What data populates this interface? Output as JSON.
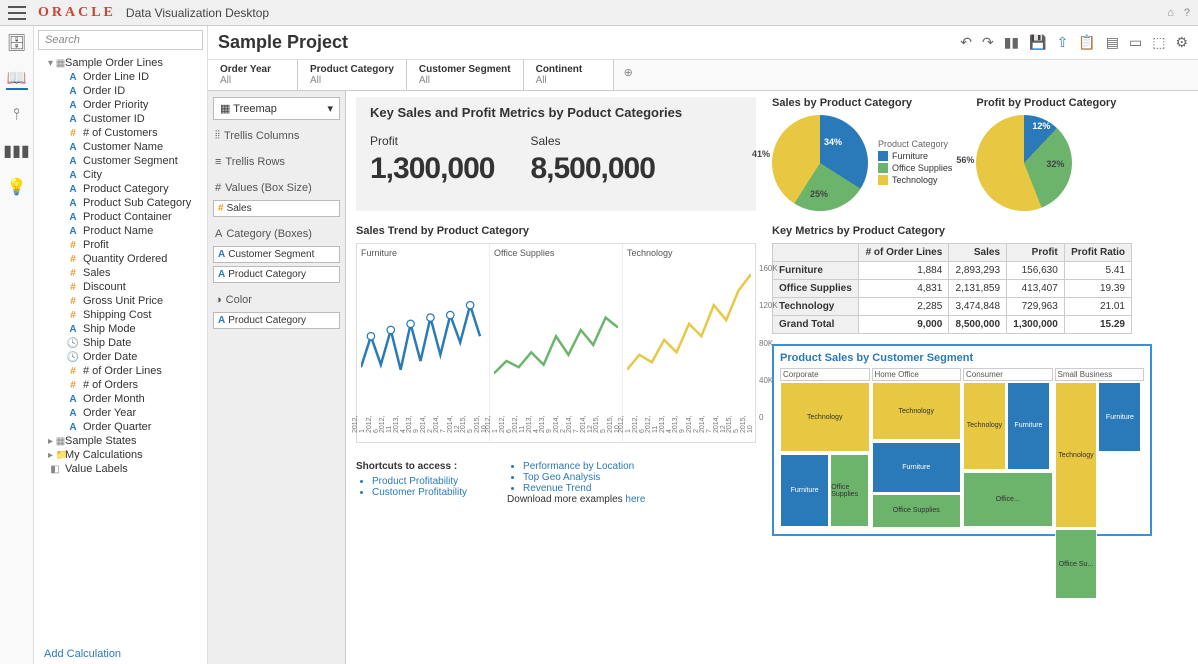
{
  "app": {
    "brand": "ORACLE",
    "name": "Data Visualization Desktop"
  },
  "search": {
    "placeholder": "Search"
  },
  "tree": {
    "root": "Sample Order Lines",
    "fields": [
      {
        "ic": "a",
        "label": "Order Line ID"
      },
      {
        "ic": "a",
        "label": "Order ID"
      },
      {
        "ic": "a",
        "label": "Order Priority"
      },
      {
        "ic": "a",
        "label": "Customer ID"
      },
      {
        "ic": "h",
        "label": "# of Customers"
      },
      {
        "ic": "a",
        "label": "Customer Name"
      },
      {
        "ic": "a",
        "label": "Customer Segment"
      },
      {
        "ic": "a",
        "label": "City"
      },
      {
        "ic": "a",
        "label": "Product Category"
      },
      {
        "ic": "a",
        "label": "Product Sub Category"
      },
      {
        "ic": "a",
        "label": "Product Container"
      },
      {
        "ic": "a",
        "label": "Product Name"
      },
      {
        "ic": "h",
        "label": "Profit"
      },
      {
        "ic": "h",
        "label": "Quantity Ordered"
      },
      {
        "ic": "h",
        "label": "Sales"
      },
      {
        "ic": "h",
        "label": "Discount"
      },
      {
        "ic": "h",
        "label": "Gross Unit Price"
      },
      {
        "ic": "h",
        "label": "Shipping Cost"
      },
      {
        "ic": "a",
        "label": "Ship Mode"
      },
      {
        "ic": "c",
        "label": "Ship Date"
      },
      {
        "ic": "c",
        "label": "Order Date"
      },
      {
        "ic": "h",
        "label": "# of Order Lines"
      },
      {
        "ic": "h",
        "label": "# of Orders"
      },
      {
        "ic": "a",
        "label": "Order Month"
      },
      {
        "ic": "a",
        "label": "Order Year"
      },
      {
        "ic": "a",
        "label": "Order Quarter"
      }
    ],
    "extras": [
      {
        "ic": "t",
        "label": "Sample States"
      },
      {
        "ic": "f",
        "label": "My Calculations"
      },
      {
        "ic": "v",
        "label": "Value Labels"
      }
    ],
    "add_calc": "Add Calculation"
  },
  "project": {
    "title": "Sample Project"
  },
  "filters": [
    {
      "label": "Order Year",
      "value": "All"
    },
    {
      "label": "Product Category",
      "value": "All"
    },
    {
      "label": "Customer Segment",
      "value": "All"
    },
    {
      "label": "Continent",
      "value": "All"
    }
  ],
  "config": {
    "viz_type": "Treemap",
    "shelves": {
      "trellis_cols": "Trellis Columns",
      "trellis_rows": "Trellis Rows",
      "values": "Values (Box Size)",
      "values_chip": "Sales",
      "category": "Category (Boxes)",
      "category_chips": [
        "Customer Segment",
        "Product Category"
      ],
      "color": "Color",
      "color_chip": "Product Category"
    }
  },
  "metrics": {
    "title": "Key Sales and Profit Metrics by Poduct Categories",
    "profit_label": "Profit",
    "profit_value": "1,300,000",
    "sales_label": "Sales",
    "sales_value": "8,500,000"
  },
  "pies": {
    "sales_title": "Sales by Product Category",
    "profit_title": "Profit by Product Category",
    "legend_title": "Product Category",
    "legend": [
      "Furniture",
      "Office Supplies",
      "Technology"
    ]
  },
  "chart_data": {
    "pies": [
      {
        "title": "Sales by Product Category",
        "type": "pie",
        "series": [
          {
            "name": "Furniture",
            "value": 34
          },
          {
            "name": "Office Supplies",
            "value": 25
          },
          {
            "name": "Technology",
            "value": 41
          }
        ]
      },
      {
        "title": "Profit by Product Category",
        "type": "pie",
        "series": [
          {
            "name": "Furniture",
            "value": 12
          },
          {
            "name": "Office Supplies",
            "value": 32
          },
          {
            "name": "Technology",
            "value": 56
          }
        ]
      }
    ],
    "trend": {
      "type": "line",
      "title": "Sales Trend by Product Category",
      "ylim": [
        0,
        160000
      ],
      "yticks": [
        "160K",
        "120K",
        "80K",
        "40K",
        "0"
      ],
      "x": [
        "2012, 1",
        "2012, 6",
        "2012, 11",
        "2013, 4",
        "2013, 9",
        "2014, 2",
        "2014, 7",
        "2014, 12",
        "2015, 5",
        "2015, 10"
      ],
      "series": [
        {
          "name": "Furniture",
          "color": "#2a7ab9"
        },
        {
          "name": "Office Supplies",
          "color": "#6cb36c"
        },
        {
          "name": "Technology",
          "color": "#e8c742"
        }
      ]
    },
    "table": {
      "title": "Key Metrics by Product Category",
      "columns": [
        "# of Order Lines",
        "Sales",
        "Profit",
        "Profit Ratio"
      ],
      "rows": [
        {
          "name": "Furniture",
          "cells": [
            "1,884",
            "2,893,293",
            "156,630",
            "5.41"
          ]
        },
        {
          "name": "Office Supplies",
          "cells": [
            "4,831",
            "2,131,859",
            "413,407",
            "19.39"
          ]
        },
        {
          "name": "Technology",
          "cells": [
            "2,285",
            "3,474,848",
            "729,963",
            "21.01"
          ]
        },
        {
          "name": "Grand Total",
          "cells": [
            "9,000",
            "8,500,000",
            "1,300,000",
            "15.29"
          ]
        }
      ]
    },
    "treemap": {
      "title": "Product Sales by Customer Segment",
      "segments": [
        "Corporate",
        "Home Office",
        "Consumer",
        "Small Business"
      ],
      "cells": [
        "Technology",
        "Furniture",
        "Office Supplies",
        "Office Su...",
        "Office..."
      ]
    }
  },
  "shortcuts": {
    "title": "Shortcuts to access :",
    "left": [
      "Product Profitability",
      "Customer Profitability"
    ],
    "right": [
      "Performance by Location",
      "Top Geo Analysis",
      "Revenue Trend"
    ],
    "download": "Download more examples ",
    "here": "here"
  }
}
